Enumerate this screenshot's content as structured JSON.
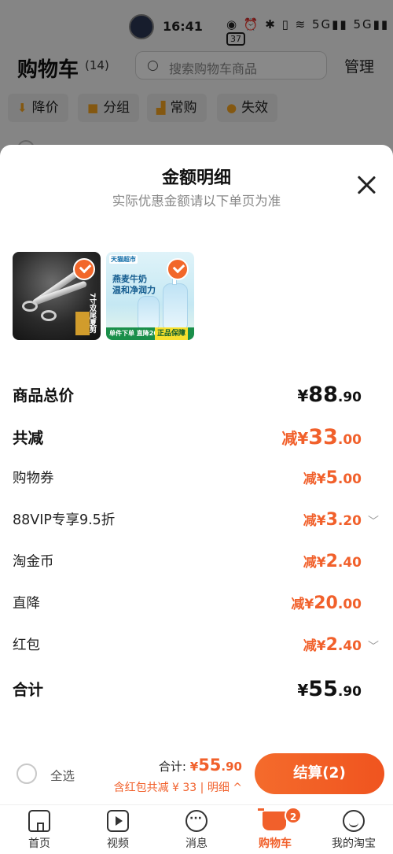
{
  "status_bar": {
    "time": "16:41",
    "icons": "◉ ⏰ ✱ ▯ ≋ 5G▮▮ 5G▮▮",
    "battery": "37"
  },
  "cart_page": {
    "title": "购物车",
    "count": "(14)",
    "search_placeholder": "搜索购物车商品",
    "manage_label": "管理",
    "chips": [
      {
        "label": "降价",
        "icon": "price-drop-icon"
      },
      {
        "label": "分组",
        "icon": "folder-icon"
      },
      {
        "label": "常购",
        "icon": "cart-icon"
      },
      {
        "label": "失效",
        "icon": "invalid-icon"
      }
    ]
  },
  "sheet": {
    "title": "金额明细",
    "subtitle": "实际优惠金额请以下单页为准",
    "products": [
      {
        "name": "scissors",
        "label": "7寸双尾夏剪"
      },
      {
        "name": "shampoo",
        "top_tag": "天猫超市",
        "line1": "燕麦牛奶",
        "line2": "温和净润力",
        "bar_text": "单件下单 直降20元",
        "badge": "正品保障"
      }
    ],
    "rows": [
      {
        "label": "商品总价",
        "prefix": "",
        "yen": "¥",
        "int": "88",
        "dec": ".90",
        "style": "total",
        "chevron": false
      },
      {
        "label": "共减",
        "prefix": "减",
        "yen": "¥",
        "int": "33",
        "dec": ".00",
        "style": "reduce",
        "chevron": false
      },
      {
        "label": "购物券",
        "prefix": "减",
        "yen": "¥",
        "int": "5",
        "dec": ".00",
        "style": "item",
        "chevron": false
      },
      {
        "label": "88VIP专享9.5折",
        "prefix": "减",
        "yen": "¥",
        "int": "3",
        "dec": ".20",
        "style": "item",
        "chevron": true
      },
      {
        "label": "淘金币",
        "prefix": "减",
        "yen": "¥",
        "int": "2",
        "dec": ".40",
        "style": "item",
        "chevron": false
      },
      {
        "label": "直降",
        "prefix": "减",
        "yen": "¥",
        "int": "20",
        "dec": ".00",
        "style": "item",
        "chevron": false
      },
      {
        "label": "红包",
        "prefix": "减",
        "yen": "¥",
        "int": "2",
        "dec": ".40",
        "style": "item",
        "chevron": true
      },
      {
        "label": "合计",
        "prefix": "",
        "yen": "¥",
        "int": "55",
        "dec": ".90",
        "style": "total",
        "chevron": false
      }
    ]
  },
  "bottom_bar": {
    "select_all": "全选",
    "sum_label": "合计:",
    "sum_yen": "¥",
    "sum_int": "55",
    "sum_dec": ".90",
    "detail_text": "含红包共减 ¥ 33 | 明细 ^",
    "checkout_label": "结算(2)"
  },
  "tab_bar": {
    "tabs": [
      {
        "label": "首页",
        "icon": "home-icon"
      },
      {
        "label": "视频",
        "icon": "video-icon"
      },
      {
        "label": "消息",
        "icon": "message-icon"
      },
      {
        "label": "购物车",
        "icon": "cart-icon",
        "badge": "2",
        "active": true
      },
      {
        "label": "我的淘宝",
        "icon": "profile-icon"
      }
    ]
  },
  "colors": {
    "accent": "#f1602b",
    "text": "#1f1f1f",
    "muted": "#888888"
  }
}
